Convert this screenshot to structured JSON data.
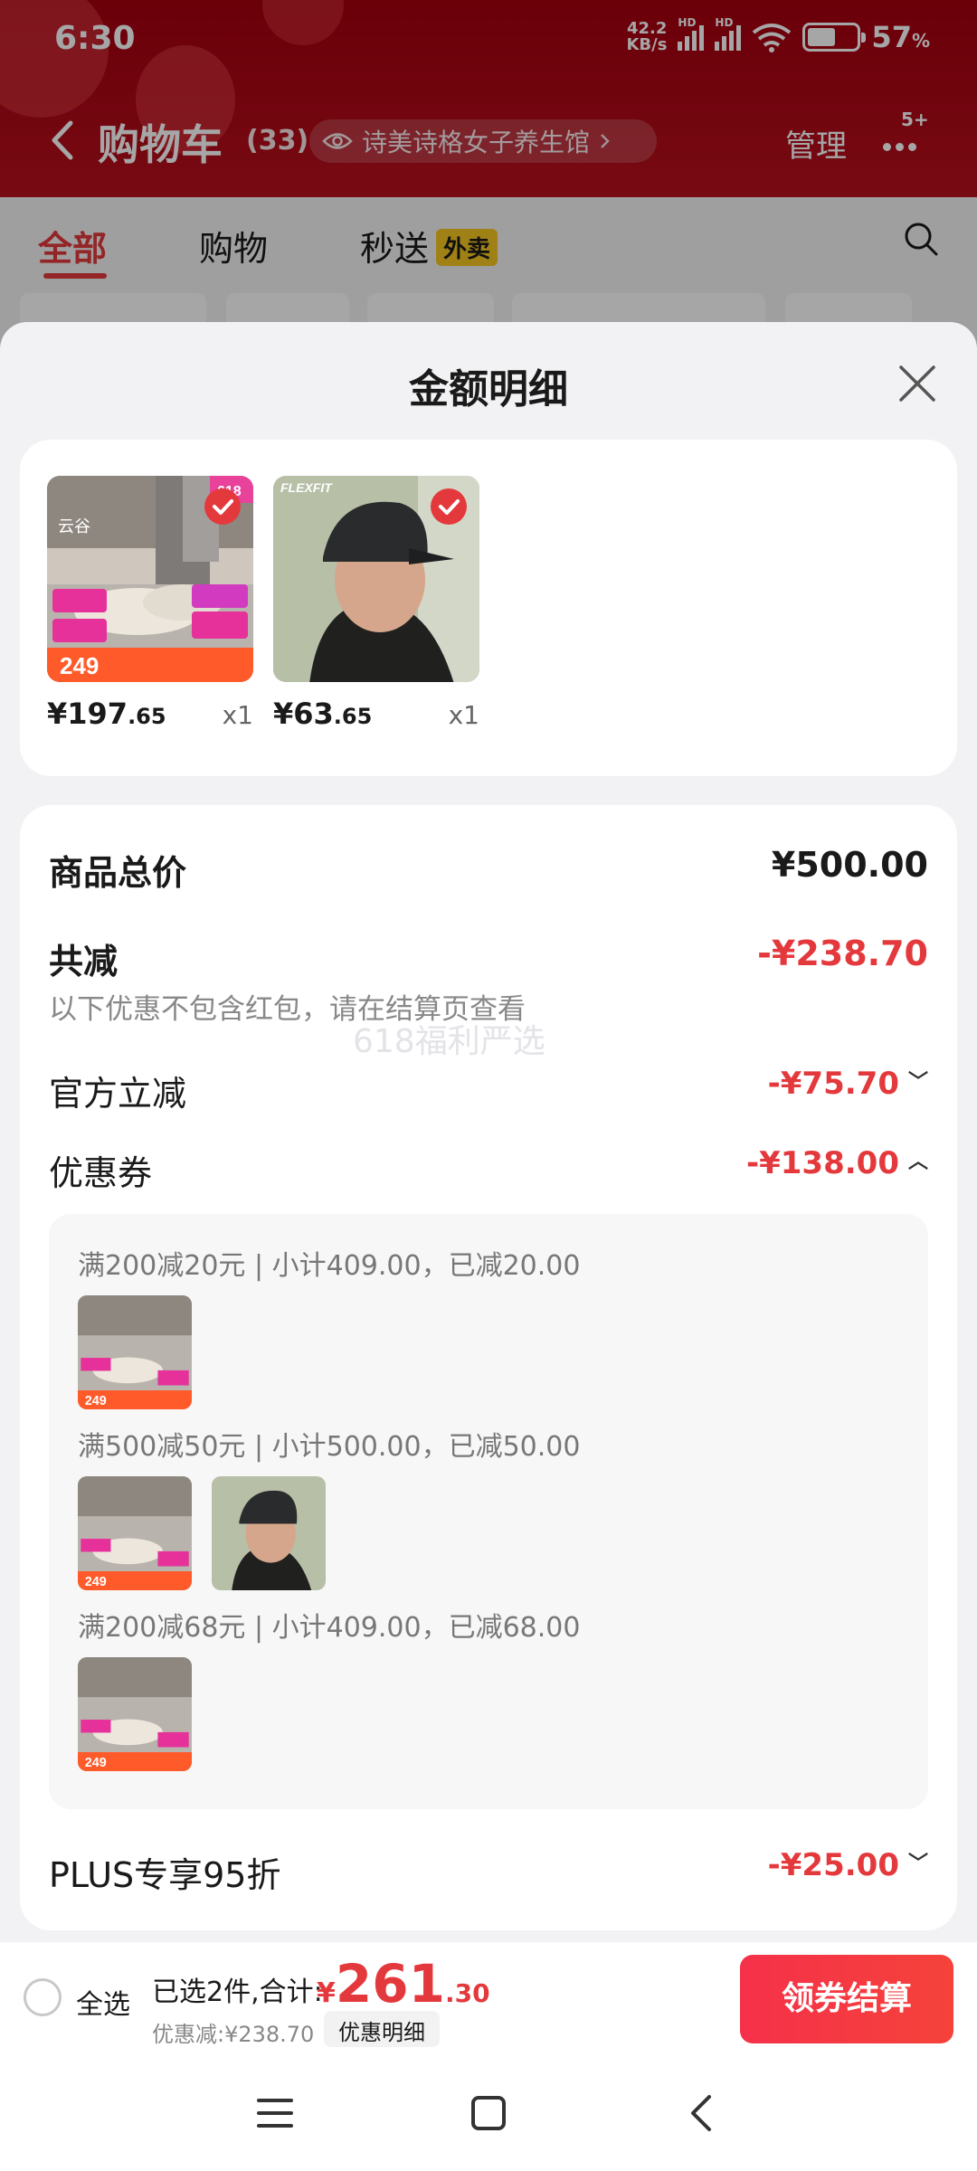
{
  "status_bar": {
    "time": "6:30",
    "net_speed_value": "42.2",
    "net_speed_unit": "KB/s",
    "battery_percent": 57,
    "battery_text": "57",
    "battery_suffix": "%"
  },
  "header": {
    "title": "购物车",
    "count": "(33)",
    "shop_name": "诗美诗格女子养生馆",
    "manage_label": "管理",
    "more_badge": "5+"
  },
  "tabs": {
    "all": "全部",
    "shopping": "购物",
    "express": "秒送",
    "express_tag": "外卖"
  },
  "sheet": {
    "title": "金额明细"
  },
  "products": [
    {
      "price_int": "¥197",
      "price_dec": ".65",
      "qty": "x1",
      "thumb_icon": "shoe-product-image"
    },
    {
      "price_int": "¥63",
      "price_dec": ".65",
      "qty": "x1",
      "thumb_icon": "cap-product-image"
    }
  ],
  "summary": {
    "total_label": "商品总价",
    "total_value": "¥500.00",
    "reduce_label": "共减",
    "reduce_value": "-¥238.70",
    "hint": "以下优惠不包含红包，请在结算页查看",
    "watermark": "618福利严选",
    "official_label": "官方立减",
    "official_value": "-¥75.70",
    "coupon_label": "优惠券",
    "coupon_value": "-¥138.00",
    "coupons": [
      {
        "text": "满200减20元 | 小计409.00，已减20.00"
      },
      {
        "text": "满500减50元 | 小计500.00，已减50.00"
      },
      {
        "text": "满200减68元 | 小计409.00，已减68.00"
      }
    ],
    "plus_label": "PLUS专享95折",
    "plus_value": "-¥25.00"
  },
  "checkout": {
    "select_all": "全选",
    "selected_text": "已选2件,合计:",
    "total_yen": "¥",
    "total_int": "261",
    "total_dec": ".30",
    "discount_text": "优惠减:¥238.70",
    "detail_label": "优惠明细",
    "button_label": "领券结算"
  },
  "colors": {
    "brand_red": "#e4393c",
    "header_red": "#b50f1c"
  }
}
